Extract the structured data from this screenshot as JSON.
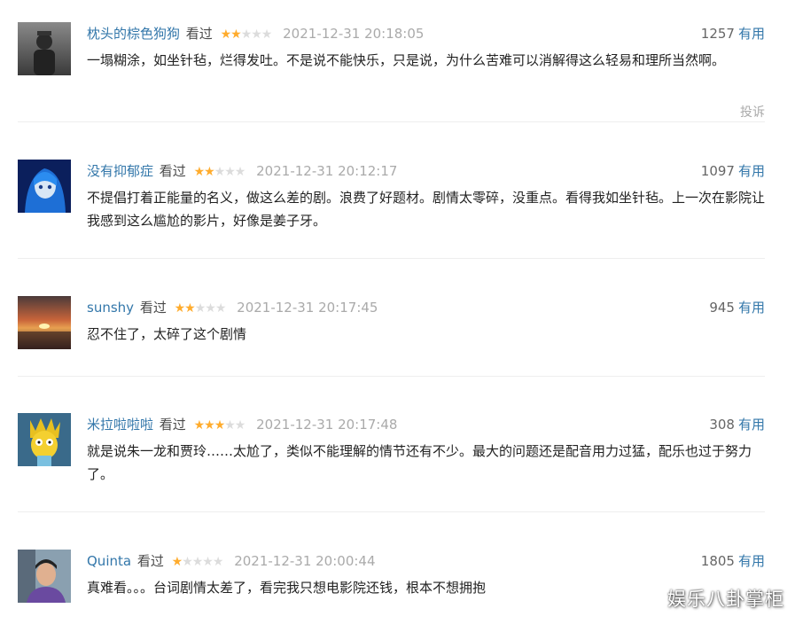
{
  "comments": [
    {
      "user": "枕头的棕色狗狗",
      "status": "看过",
      "stars_filled": 2,
      "stars_total": 5,
      "time": "2021-12-31 20:18:05",
      "votes": "1257",
      "useful_label": "有用",
      "text": "一塌糊涂，如坐针毡，烂得发吐。不是说不能快乐，只是说，为什么苦难可以消解得这么轻易和理所当然啊。",
      "report_label": "投诉"
    },
    {
      "user": "没有抑郁症",
      "status": "看过",
      "stars_filled": 2,
      "stars_total": 5,
      "time": "2021-12-31 20:12:17",
      "votes": "1097",
      "useful_label": "有用",
      "text": "不提倡打着正能量的名义，做这么差的剧。浪费了好题材。剧情太零碎，没重点。看得我如坐针毡。上一次在影院让我感到这么尴尬的影片，好像是姜子牙。"
    },
    {
      "user": "sunshy",
      "status": "看过",
      "stars_filled": 2,
      "stars_total": 5,
      "time": "2021-12-31 20:17:45",
      "votes": "945",
      "useful_label": "有用",
      "text": "忍不住了，太碎了这个剧情"
    },
    {
      "user": "米拉啦啦啦",
      "status": "看过",
      "stars_filled": 3,
      "stars_total": 5,
      "time": "2021-12-31 20:17:48",
      "votes": "308",
      "useful_label": "有用",
      "text": "就是说朱一龙和贾玲……太尬了，类似不能理解的情节还有不少。最大的问题还是配音用力过猛，配乐也过于努力了。"
    },
    {
      "user": "Quinta",
      "status": "看过",
      "stars_filled": 1,
      "stars_total": 5,
      "time": "2021-12-31 20:00:44",
      "votes": "1805",
      "useful_label": "有用",
      "text": "真难看。。。台词剧情太差了，看完我只想电影院还钱，根本不想拥抱"
    }
  ],
  "watermark": "娱乐八卦掌柜",
  "colors": {
    "link": "#3377aa",
    "star": "#ffac2d",
    "muted": "#aaaaaa",
    "text": "#222222"
  }
}
